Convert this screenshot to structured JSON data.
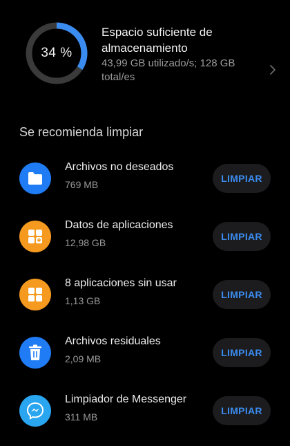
{
  "storage": {
    "percent": 34,
    "percent_label": "34 %",
    "title": "Espacio suficiente de almacenamiento",
    "detail": "43,99 GB utilizado/s; 128 GB total/es"
  },
  "recommend": {
    "section_title": "Se recomienda limpiar",
    "items": [
      {
        "title": "Archivos no deseados",
        "size": "769 MB",
        "button": "LIMPIAR",
        "icon": "folder-icon",
        "color": "#1f7cf5"
      },
      {
        "title": "Datos de aplicaciones",
        "size": "12,98 GB",
        "button": "LIMPIAR",
        "icon": "app-data-icon",
        "color": "#f59a1f"
      },
      {
        "title": "8 aplicaciones sin usar",
        "size": "1,13 GB",
        "button": "LIMPIAR",
        "icon": "apps-grid-icon",
        "color": "#f59a1f"
      },
      {
        "title": "Archivos residuales",
        "size": "2,09 MB",
        "button": "LIMPIAR",
        "icon": "trash-icon",
        "color": "#1f7cf5"
      },
      {
        "title": "Limpiador de Messenger",
        "size": "311 MB",
        "button": "LIMPIAR",
        "icon": "messenger-icon",
        "color": "#2aa5f0"
      }
    ]
  },
  "colors": {
    "accent": "#3b8cf0",
    "ring_fill": "#3b8cf0",
    "ring_track": "#3a3a3a"
  }
}
